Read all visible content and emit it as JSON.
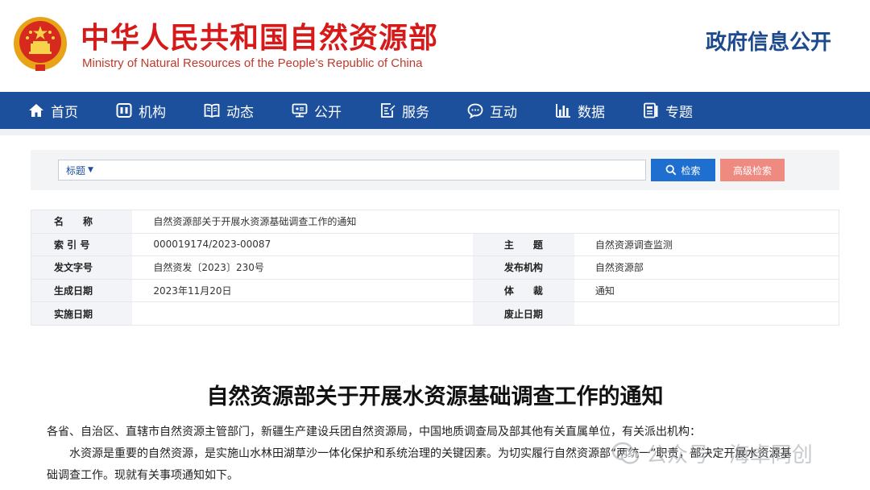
{
  "header": {
    "brand_cn": "中华人民共和国自然资源部",
    "brand_en": "Ministry of Natural Resources of the People’s Republic of China",
    "gov_info": "政府信息公开",
    "colors": {
      "brand_red": "#d61a1a",
      "nav_blue": "#1c4f9c"
    }
  },
  "nav": {
    "items": [
      {
        "label": "首页",
        "icon": "home-icon"
      },
      {
        "label": "机构",
        "icon": "org-icon"
      },
      {
        "label": "动态",
        "icon": "book-icon"
      },
      {
        "label": "公开",
        "icon": "screen-icon"
      },
      {
        "label": "服务",
        "icon": "edit-doc-icon"
      },
      {
        "label": "互动",
        "icon": "chat-icon"
      },
      {
        "label": "数据",
        "icon": "bar-chart-icon"
      },
      {
        "label": "专题",
        "icon": "topic-icon"
      }
    ]
  },
  "search": {
    "field_label": "标题",
    "query": "",
    "search_button": "检索",
    "advanced_button": "高级检索"
  },
  "meta": {
    "name_label": "名　　称",
    "name_value": "自然资源部关于开展水资源基础调查工作的通知",
    "index_label": "索 引 号",
    "index_value": "000019174/2023-00087",
    "subject_label": "主　　题",
    "subject_value": "自然资源调查监测",
    "docno_label": "发文字号",
    "docno_value": "自然资发〔2023〕230号",
    "issuer_label": "发布机构",
    "issuer_value": "自然资源部",
    "date_label": "生成日期",
    "date_value": "2023年11月20日",
    "genre_label": "体　　裁",
    "genre_value": "通知",
    "effective_label": "实施日期",
    "effective_value": "",
    "expiry_label": "废止日期",
    "expiry_value": ""
  },
  "article": {
    "title": "自然资源部关于开展水资源基础调查工作的通知",
    "p1": "各省、自治区、直辖市自然资源主管部门，新疆生产建设兵团自然资源局，中国地质调查局及部其他有关直属单位，有关派出机构：",
    "p2": "水资源是重要的自然资源，是实施山水林田湖草沙一体化保护和系统治理的关键因素。为切实履行自然资源部“两统一”职责，部决定开展水资源基",
    "p3": "础调查工作。现就有关事项通知如下。"
  },
  "watermark": {
    "text": "公众号 · 海卓同创"
  }
}
